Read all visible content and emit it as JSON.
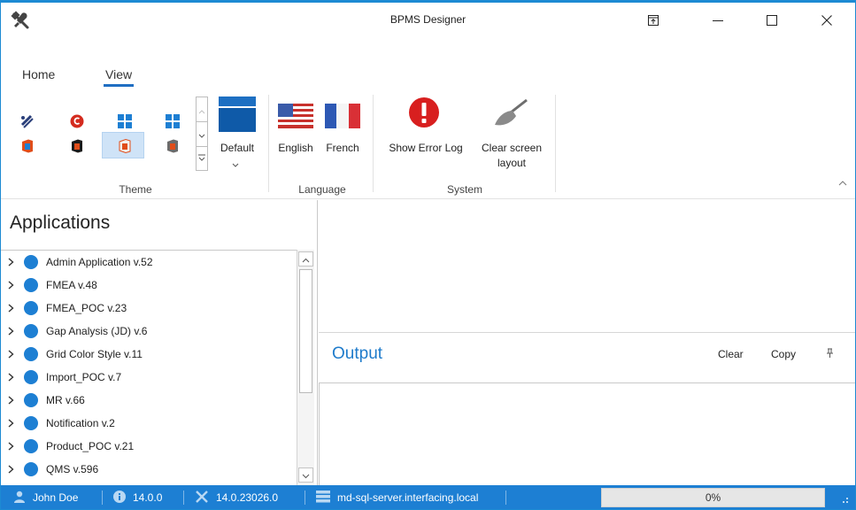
{
  "window": {
    "title": "BPMS Designer",
    "accent": "#1d7fd3",
    "app_icon": "tools-icon",
    "controls": [
      "restore-ribbon-icon",
      "minimize-icon",
      "maximize-icon",
      "close-icon"
    ]
  },
  "ribbon": {
    "tabs": [
      {
        "label": "Home",
        "active": false
      },
      {
        "label": "View",
        "active": true
      }
    ],
    "theme": {
      "group_label": "Theme",
      "default_label": "Default",
      "swatches": [
        "bezier-icon",
        "office-red-icon",
        "windows-blue-icon",
        "windows-blue-icon",
        "office-orange-icon",
        "office-black-icon",
        "office-white-icon",
        "office-gray-icon"
      ]
    },
    "language": {
      "group_label": "Language",
      "english": "English",
      "french": "French"
    },
    "system": {
      "group_label": "System",
      "show_error_log": "Show Error Log",
      "clear_screen_line1": "Clear screen",
      "clear_screen_line2": "layout"
    }
  },
  "applications": {
    "title": "Applications",
    "items": [
      "Admin Application v.52",
      "FMEA v.48",
      "FMEA_POC v.23",
      "Gap Analysis (JD) v.6",
      "Grid Color Style v.11",
      "Import_POC v.7",
      "MR v.66",
      "Notification v.2",
      "Product_POC v.21",
      "QMS v.596"
    ]
  },
  "output": {
    "title": "Output",
    "clear_label": "Clear",
    "copy_label": "Copy"
  },
  "statusbar": {
    "user": "John Doe",
    "version": "14.0.0",
    "build": "14.0.23026.0",
    "server": "md-sql-server.interfacing.local",
    "progress_percent": 0,
    "progress_text": "0%"
  }
}
